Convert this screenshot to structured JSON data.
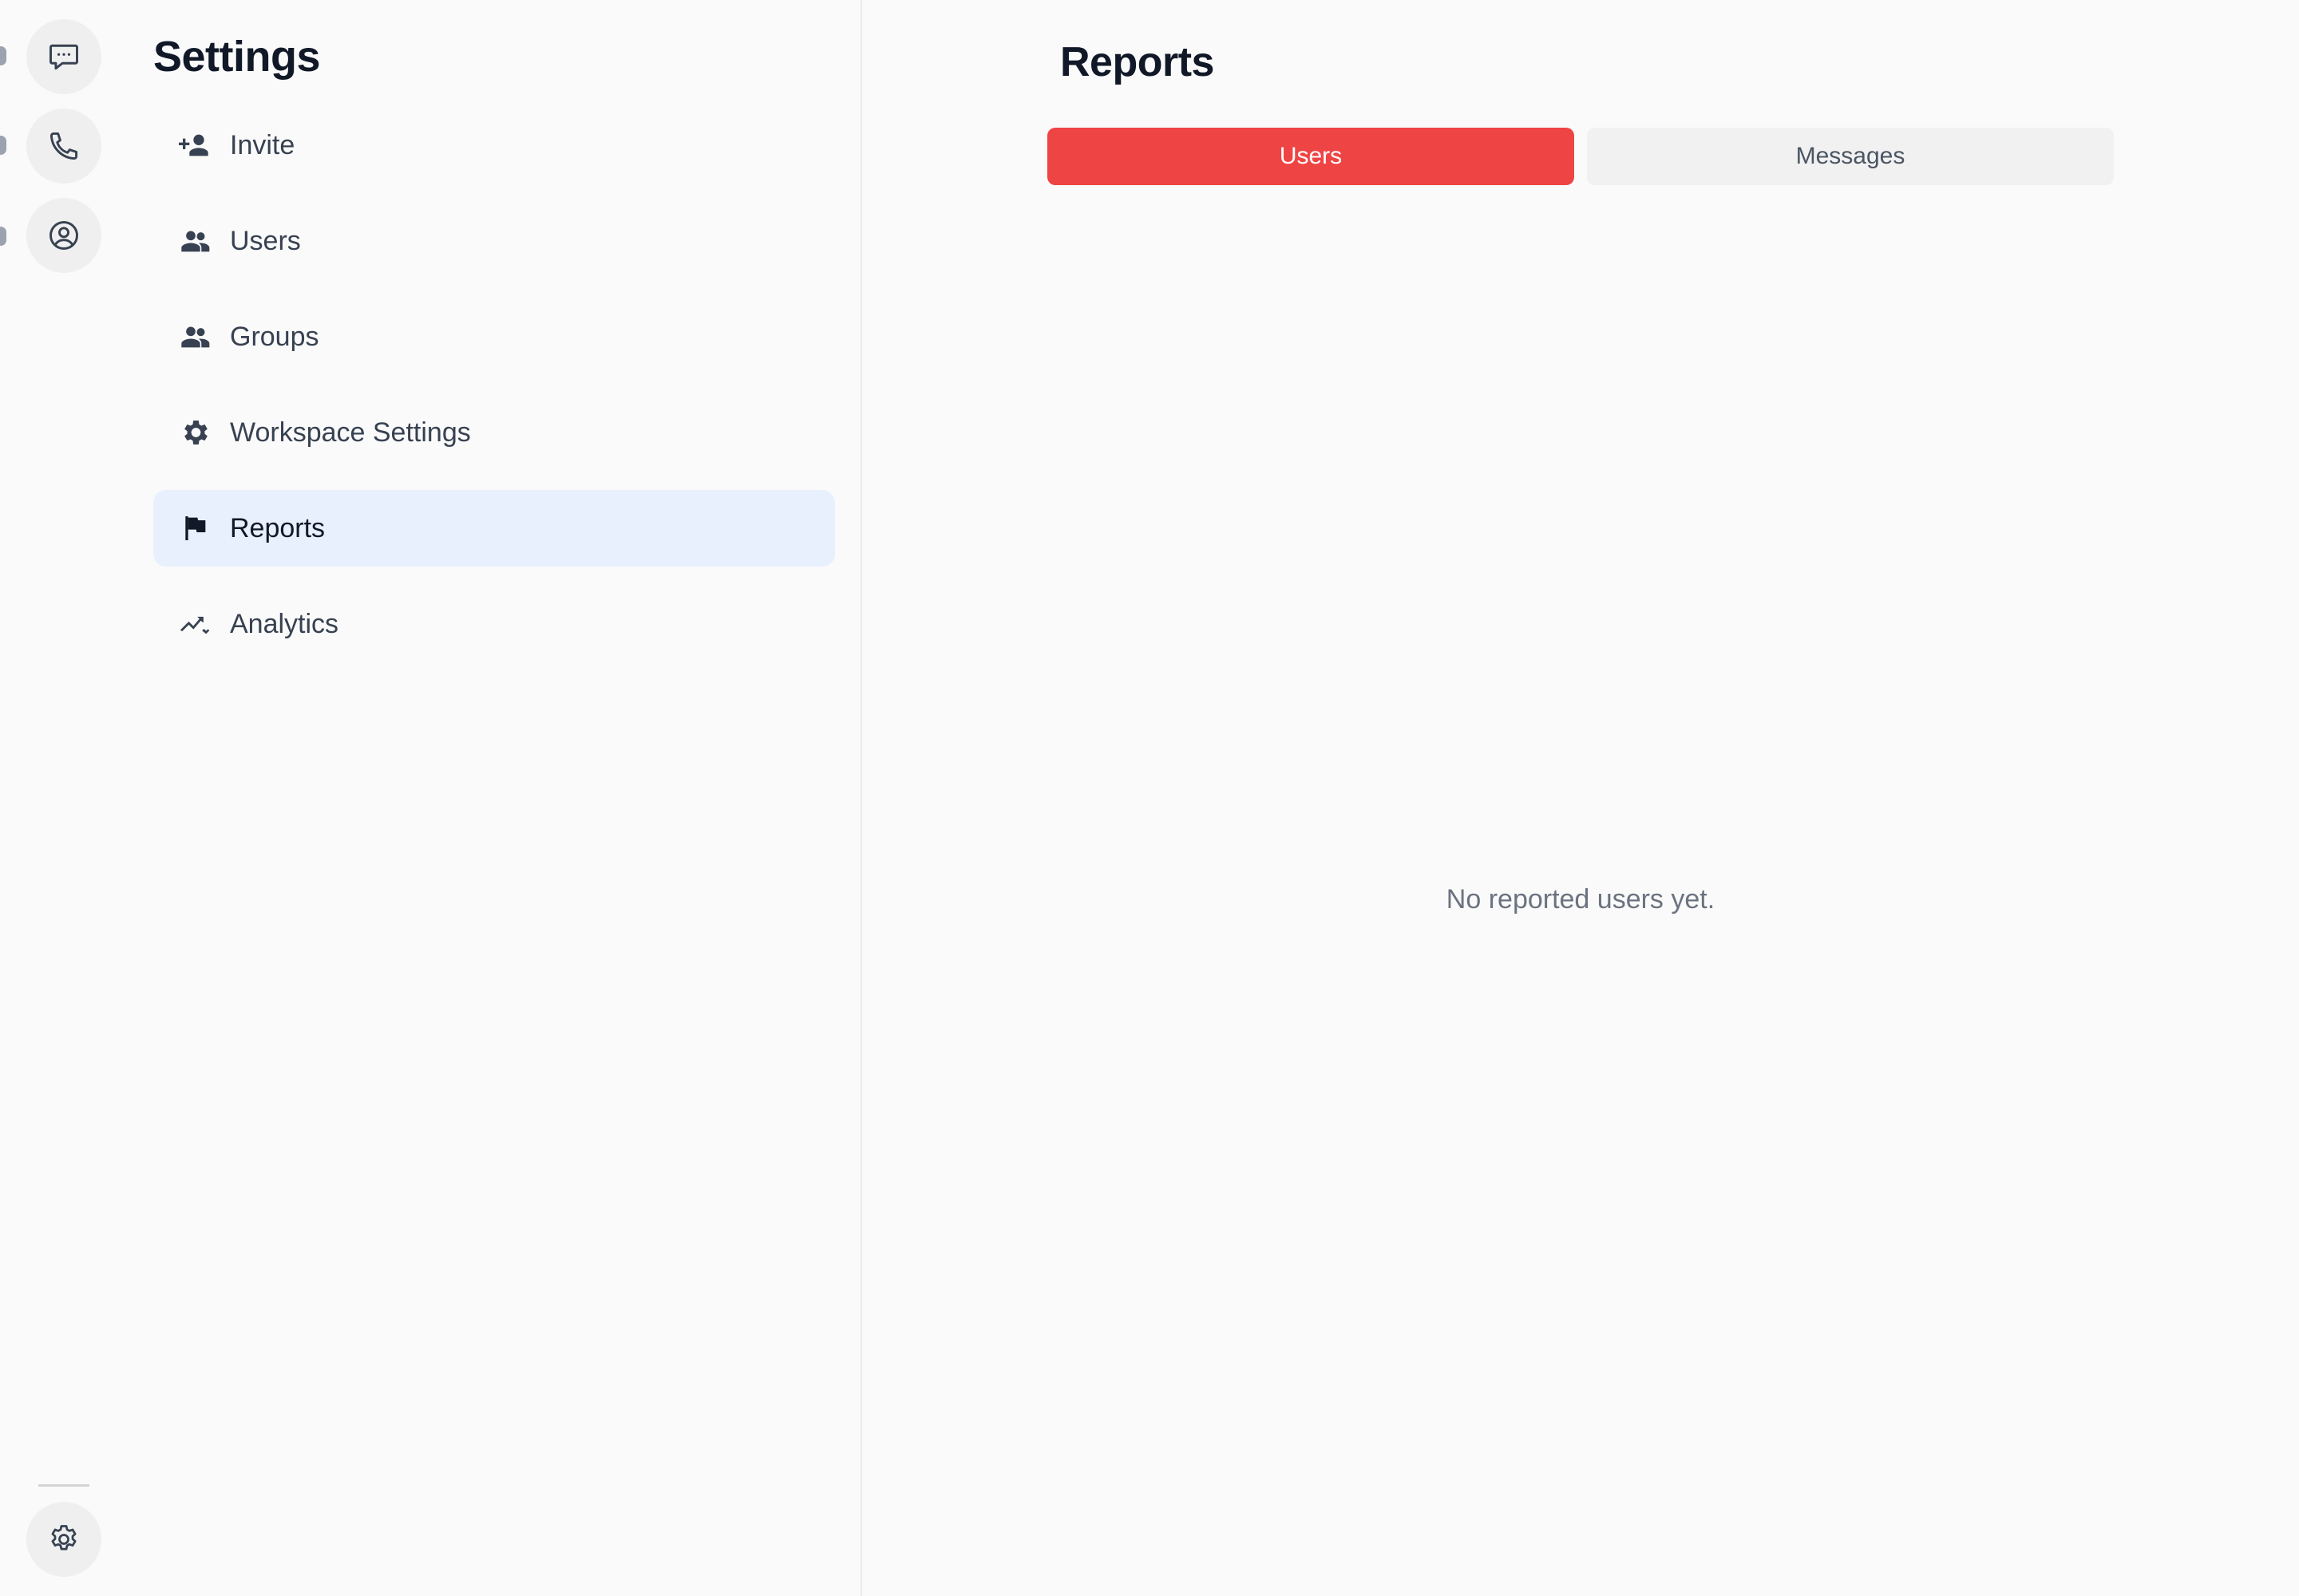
{
  "rail": {
    "items": [
      {
        "name": "chat",
        "icon": "chat-bubble-icon"
      },
      {
        "name": "calls",
        "icon": "phone-icon"
      },
      {
        "name": "profile",
        "icon": "user-circle-icon"
      }
    ],
    "bottom_icon": "gear-icon"
  },
  "settings": {
    "title": "Settings",
    "items": [
      {
        "label": "Invite",
        "icon": "person-add-icon"
      },
      {
        "label": "Users",
        "icon": "people-icon"
      },
      {
        "label": "Groups",
        "icon": "people-icon"
      },
      {
        "label": "Workspace Settings",
        "icon": "gear-icon"
      },
      {
        "label": "Reports",
        "icon": "flag-icon",
        "active": true
      },
      {
        "label": "Analytics",
        "icon": "trend-icon"
      }
    ]
  },
  "main": {
    "title": "Reports",
    "tabs": [
      {
        "label": "Users",
        "active": true
      },
      {
        "label": "Messages",
        "active": false
      }
    ],
    "empty_state": "No reported users yet."
  },
  "colors": {
    "accent": "#ef4444",
    "active_nav_bg": "#e8f0fd",
    "background": "#fafafa"
  }
}
